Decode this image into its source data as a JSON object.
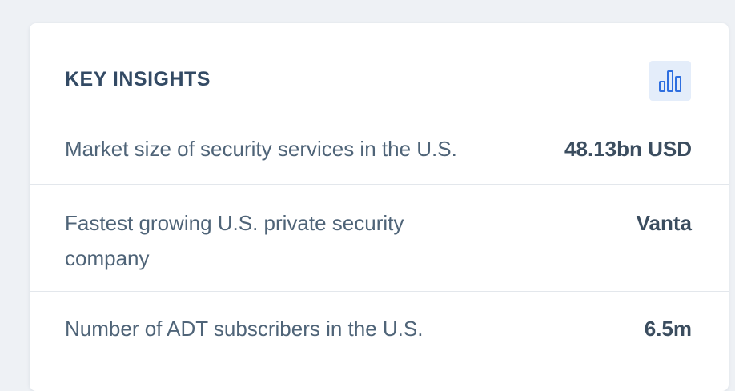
{
  "card": {
    "title": "KEY INSIGHTS",
    "chart_button_icon": "bar-chart-icon",
    "rows": [
      {
        "label": "Market size of security services in the U.S.",
        "value": "48.13bn USD"
      },
      {
        "label": "Fastest growing U.S. private security company",
        "value": "Vanta"
      },
      {
        "label": "Number of ADT subscribers in the U.S.",
        "value": "6.5m"
      }
    ]
  },
  "colors": {
    "accent": "#2f6fe0",
    "accent_bg": "#e4edfa",
    "title": "#334a64",
    "label": "#4f6478",
    "value": "#3b4d5f"
  }
}
